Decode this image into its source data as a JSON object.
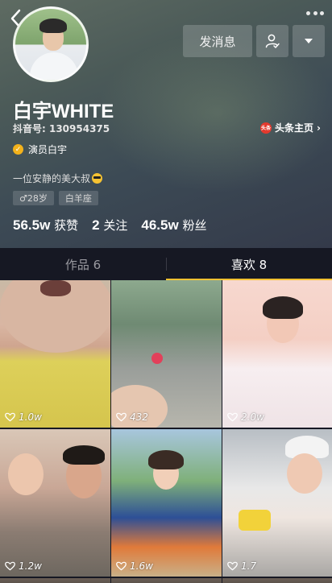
{
  "profile": {
    "name": "白宇WHITE",
    "douyin_id": "抖音号: 130954375",
    "toutiao_label": "头条主页",
    "toutiao_badge": "头条",
    "verified_label": "演员白宇",
    "bio": "一位安静的美大叔",
    "tags": [
      "♂28岁",
      "白羊座"
    ],
    "stats": [
      {
        "value": "56.5w",
        "label": "获赞"
      },
      {
        "value": "2",
        "label": "关注"
      },
      {
        "value": "46.5w",
        "label": "粉丝"
      }
    ]
  },
  "actions": {
    "message_label": "发消息"
  },
  "tabs": [
    {
      "label": "作品 6",
      "active": false
    },
    {
      "label": "喜欢 8",
      "active": true
    }
  ],
  "videos": [
    {
      "likes": "1.0w"
    },
    {
      "likes": "432"
    },
    {
      "likes": "2.0w"
    },
    {
      "likes": "1.2w"
    },
    {
      "likes": "1.6w"
    },
    {
      "likes": "1.7"
    }
  ],
  "colors": {
    "accent": "#f5c232",
    "background": "#161823",
    "verified": "#f3b21b",
    "toutiao": "#e43a2e"
  },
  "icons": [
    "back-icon",
    "more-icon",
    "follow-user-icon",
    "chevron-down-icon",
    "verified-icon",
    "heart-icon"
  ]
}
